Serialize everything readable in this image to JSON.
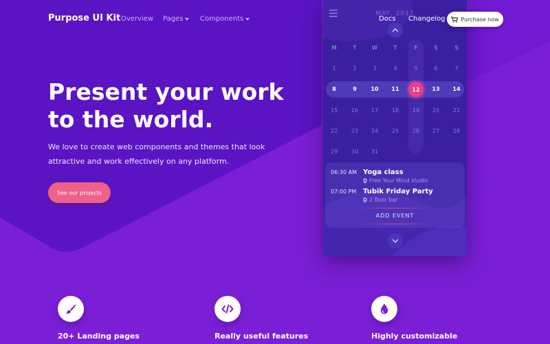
{
  "colors": {
    "background": "#7b1fd6",
    "hero_band": "#5a14c4",
    "accent_pink": "#ef6188",
    "calendar_bg": "#3a1fa0",
    "weekday_teal": "#6fd1c4",
    "selected_day": "#e83f8b"
  },
  "nav": {
    "brand": "Purpose UI Kit",
    "links": [
      {
        "label": "Overview",
        "dropdown": false
      },
      {
        "label": "Pages",
        "dropdown": true
      },
      {
        "label": "Components",
        "dropdown": true
      }
    ],
    "right_links": [
      "Docs",
      "Changelog"
    ],
    "purchase": {
      "label": "Purchase now",
      "icon": "cart-icon"
    }
  },
  "hero": {
    "title": "Present your work to the world.",
    "subtitle": "We love to create web components and themes that look attractive and work effectively on any platform.",
    "cta": "See our projects"
  },
  "calendar": {
    "menu_icon": "menu-icon",
    "month": "MAY, 2017",
    "weekdays": [
      "M",
      "T",
      "W",
      "T",
      "F",
      "S",
      "S"
    ],
    "current_weekday_index": 4,
    "weeks": [
      [
        "1",
        "2",
        "3",
        "4",
        "5",
        "6",
        "7"
      ],
      [
        "8",
        "9",
        "10",
        "11",
        "12",
        "13",
        "14"
      ],
      [
        "15",
        "16",
        "17",
        "18",
        "19",
        "20",
        "21"
      ],
      [
        "22",
        "23",
        "24",
        "25",
        "26",
        "27",
        "28"
      ],
      [
        "29",
        "30",
        "31"
      ]
    ],
    "highlighted_week_index": 1,
    "selected_day": "12",
    "events": [
      {
        "time": "06:30 AM",
        "title": "Yoga class",
        "place": "Free Your Mind studio"
      },
      {
        "time": "07:00 PM",
        "title": "Tubik Friday Party",
        "place": "2 floor bar"
      }
    ],
    "add_event": "ADD EVENT"
  },
  "features": [
    {
      "label": "20+ Landing pages",
      "icon": "brush-icon"
    },
    {
      "label": "Really useful features",
      "icon": "code-icon"
    },
    {
      "label": "Highly customizable",
      "icon": "droplet-icon"
    }
  ]
}
